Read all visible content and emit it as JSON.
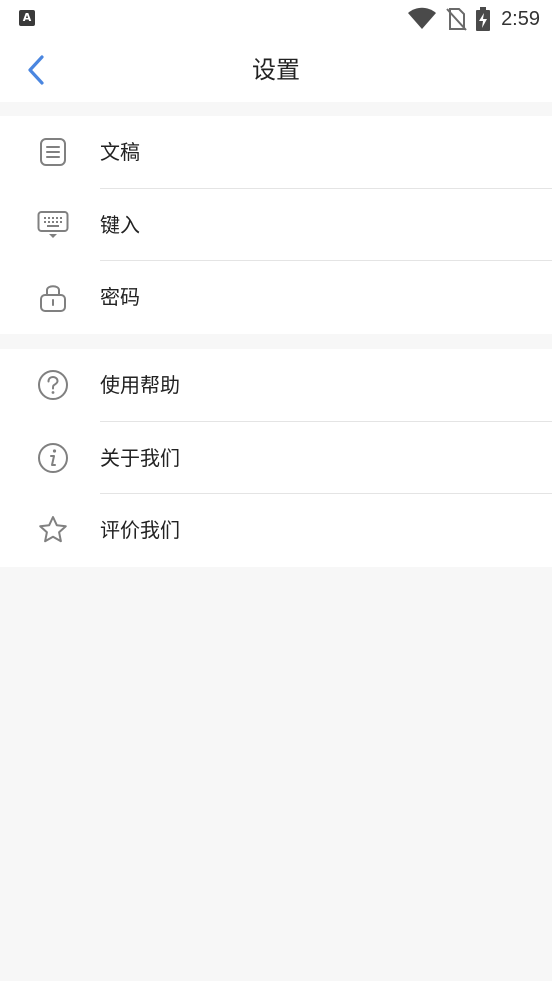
{
  "status_bar": {
    "time": "2:59",
    "app_icon_letter": "A"
  },
  "header": {
    "title": "设置"
  },
  "groups": [
    {
      "items": [
        {
          "label": "文稿",
          "icon": "document-icon"
        },
        {
          "label": "键入",
          "icon": "keyboard-icon"
        },
        {
          "label": "密码",
          "icon": "lock-icon"
        }
      ]
    },
    {
      "items": [
        {
          "label": "使用帮助",
          "icon": "help-icon"
        },
        {
          "label": "关于我们",
          "icon": "info-icon"
        },
        {
          "label": "评价我们",
          "icon": "star-icon"
        }
      ]
    }
  ],
  "colors": {
    "accent": "#4a86e0",
    "icon_gray": "#808080",
    "background": "#f7f7f7",
    "divider": "#e4e4e4"
  }
}
